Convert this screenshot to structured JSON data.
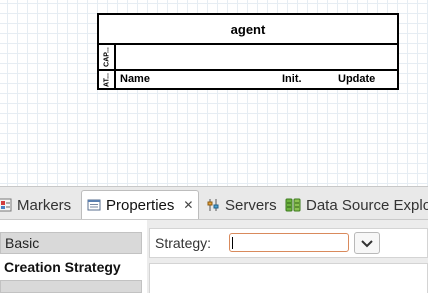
{
  "diagram": {
    "agent_title": "agent",
    "capability_section_label": "CAP...",
    "attribute_section_label": "AT...",
    "columns": {
      "name": "Name",
      "init": "Init.",
      "update": "Update"
    }
  },
  "tabs": [
    {
      "label": "Markers",
      "icon": "markers-icon",
      "active": false
    },
    {
      "label": "Properties",
      "icon": "properties-icon",
      "active": true,
      "closable": true
    },
    {
      "label": "Servers",
      "icon": "servers-icon",
      "active": false
    },
    {
      "label": "Data Source Explo",
      "icon": "data-source-icon",
      "active": false
    }
  ],
  "properties": {
    "categories": [
      "Basic",
      "Creation Strategy"
    ],
    "strategy_label": "Strategy:",
    "strategy_value": ""
  },
  "colors": {
    "input_focus_border": "#d98a5c",
    "grid_line": "#e6edf3",
    "tab_bar": "#e9e9e9"
  }
}
